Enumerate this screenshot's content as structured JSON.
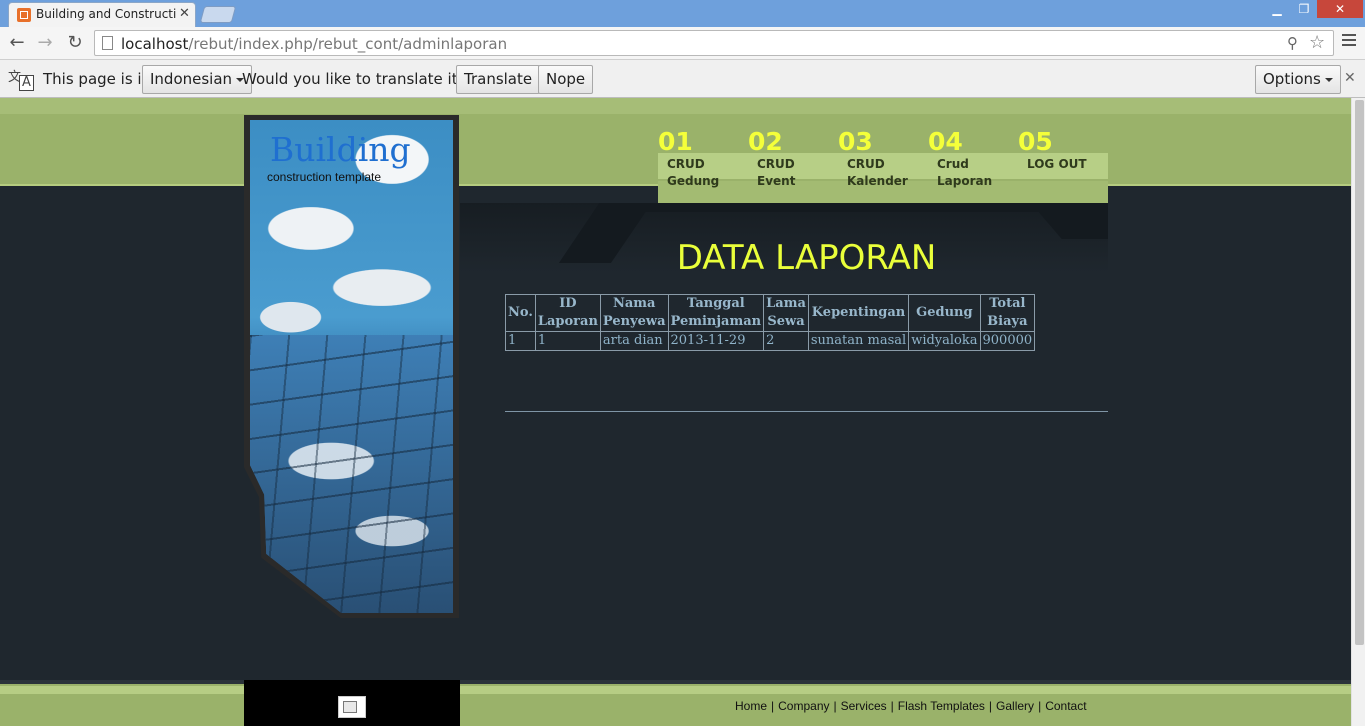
{
  "browser": {
    "tab_title": "Building and Construction",
    "url_host": "localhost",
    "url_path": "/rebut/index.php/rebut_cont/adminlaporan"
  },
  "translate_bar": {
    "prefix": "This page is in",
    "language": "Indonesian",
    "question": "Would you like to translate it?",
    "translate_label": "Translate",
    "nope_label": "Nope",
    "options_label": "Options"
  },
  "site": {
    "title": "Building",
    "subtitle": "construction template"
  },
  "nav": [
    {
      "num": "01",
      "label": "CRUD\nGedung"
    },
    {
      "num": "02",
      "label": "CRUD\nEvent"
    },
    {
      "num": "03",
      "label": "CRUD\nKalender"
    },
    {
      "num": "04",
      "label": "Crud\nLaporan"
    },
    {
      "num": "05",
      "label": "LOG OUT"
    }
  ],
  "main": {
    "heading": "DATA LAPORAN",
    "table": {
      "headers": [
        [
          "No."
        ],
        [
          "ID",
          "Laporan"
        ],
        [
          "Nama",
          "Penyewa"
        ],
        [
          "Tanggal",
          "Peminjaman"
        ],
        [
          "Lama",
          "Sewa"
        ],
        [
          "Kepentingan"
        ],
        [
          "Gedung"
        ],
        [
          "Total",
          "Biaya"
        ]
      ],
      "rows": [
        [
          "1",
          "1",
          "arta dian",
          "2013-11-29",
          "2",
          "sunatan masal",
          "widyaloka",
          "900000"
        ]
      ]
    }
  },
  "footer": {
    "links": [
      "Home",
      "Company",
      "Services",
      "Flash Templates",
      "Gallery",
      "Contact"
    ]
  },
  "colors": {
    "accent_green": "#9ab26a",
    "heading_yellow": "#eaff3a",
    "background_dark": "#1f272e"
  }
}
